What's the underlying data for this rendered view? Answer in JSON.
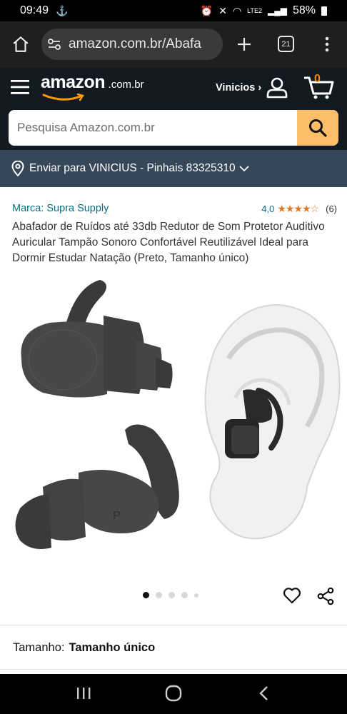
{
  "status": {
    "time": "09:49",
    "battery": "58%",
    "network": "LTE2"
  },
  "browser": {
    "url": "amazon.com.br/Abafa",
    "tab_count": "21"
  },
  "header": {
    "logo": "amazon",
    "logo_suffix": ".com.br",
    "account_label": "Vinicios ›",
    "cart_count": "0"
  },
  "search": {
    "placeholder": "Pesquisa Amazon.com.br"
  },
  "deliver": {
    "text": "Enviar para VINICIUS - Pinhais 83325310"
  },
  "product": {
    "brand": "Marca: Supra Supply",
    "rating_value": "4,0",
    "stars": 4,
    "stars_glyphs": "★★★★☆",
    "rating_count": "(6)",
    "title": "Abafador de Ruídos até 33db Redutor de Som Protetor Auditivo Auricular Tampão Sonoro Confortável Reutilizável Ideal para Dormir Estudar Natação (Preto, Tamanho único)",
    "image_count": 5,
    "active_image": 1
  },
  "size": {
    "label": "Tamanho:",
    "value": "Tamanho único"
  },
  "colors": {
    "header_bg": "#131921",
    "deliver_bg": "#37475a",
    "search_button": "#febd69",
    "link": "#007185",
    "star": "#de7921",
    "cart_count": "#f08804"
  }
}
